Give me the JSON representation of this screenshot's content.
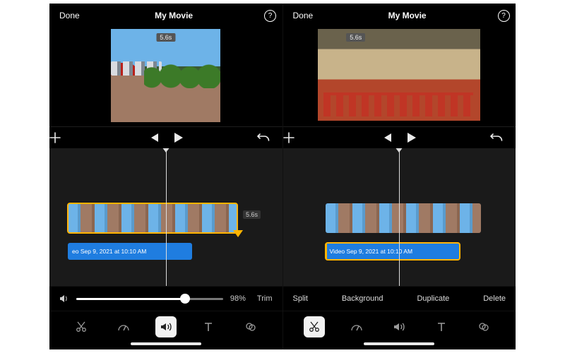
{
  "header": {
    "done": "Done",
    "title": "My Movie",
    "help": "?"
  },
  "preview": {
    "clip_duration": "5.6s"
  },
  "timeline": {
    "clip_duration_badge": "5.6s",
    "audio_label_left": "eo Sep 9, 2021 at 10:10 AM",
    "audio_label_right": "Video Sep 9, 2021 at 10:10 AM"
  },
  "volume": {
    "percent": "98%",
    "trim_label": "Trim",
    "fill_pct": 74
  },
  "actions": {
    "split": "Split",
    "background": "Background",
    "duplicate": "Duplicate",
    "delete": "Delete"
  },
  "tool_names": {
    "cut": "scissors-icon",
    "speed": "speed-icon",
    "audio": "speaker-icon",
    "text": "text-icon",
    "filter": "filter-icon"
  }
}
